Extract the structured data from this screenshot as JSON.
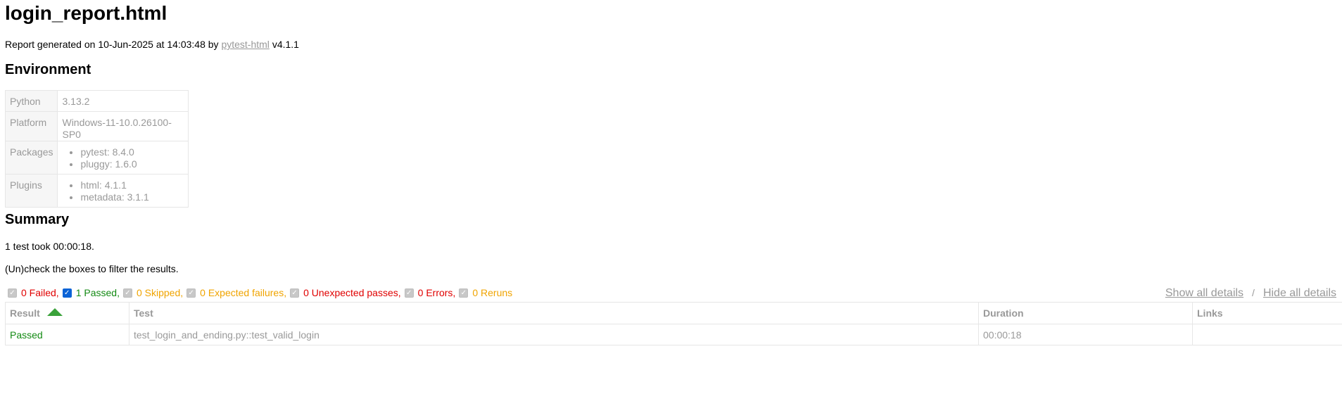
{
  "report": {
    "title": "login_report.html",
    "generated_prefix": "Report generated on 10-Jun-2025 at 14:03:48 by",
    "generator_link": "pytest-html",
    "generator_version": "v4.1.1"
  },
  "environment": {
    "heading": "Environment",
    "python_key": "Python",
    "python_value": "3.13.2",
    "platform_key": "Platform",
    "platform_value": "Windows-11-10.0.26100-SP0",
    "packages_key": "Packages",
    "packages": [
      "pytest: 8.4.0",
      "pluggy: 1.6.0"
    ],
    "plugins_key": "Plugins",
    "plugins": [
      "html: 4.1.1",
      "metadata: 3.1.1"
    ]
  },
  "summary": {
    "heading": "Summary",
    "count_text": "1 test took 00:00:18.",
    "filter_hint": "(Un)check the boxes to filter the results.",
    "filters": {
      "failed": {
        "label": "0 Failed,",
        "checked": true,
        "enabled": false
      },
      "passed": {
        "label": "1 Passed,",
        "checked": true,
        "enabled": true
      },
      "skipped": {
        "label": "0 Skipped,",
        "checked": true,
        "enabled": false
      },
      "xfailed": {
        "label": "0 Expected failures,",
        "checked": true,
        "enabled": false
      },
      "xpassed": {
        "label": "0 Unexpected passes,",
        "checked": true,
        "enabled": false
      },
      "errors": {
        "label": "0 Errors,",
        "checked": true,
        "enabled": false
      },
      "reruns": {
        "label": "0 Reruns",
        "checked": true,
        "enabled": false
      }
    },
    "show_all": "Show all details",
    "separator": "/",
    "hide_all": "Hide all details"
  },
  "results": {
    "columns": {
      "result": "Result",
      "test": "Test",
      "duration": "Duration",
      "links": "Links"
    },
    "sort": {
      "column": "Result",
      "direction": "ascending"
    },
    "rows": [
      {
        "result": "Passed",
        "test": "test_login_and_ending.py::test_valid_login",
        "duration": "00:00:18",
        "links": ""
      }
    ]
  },
  "colors": {
    "failed": "#e00000",
    "passed": "#138a13",
    "skipped": "#f0a400",
    "muted": "#999999",
    "sort_arrow": "#3aa23a",
    "checkbox_checked": "#0b63d6"
  },
  "icons": {
    "sort": "sort-ascending-arrow-icon",
    "checkbox_checked": "checkmark-icon"
  }
}
